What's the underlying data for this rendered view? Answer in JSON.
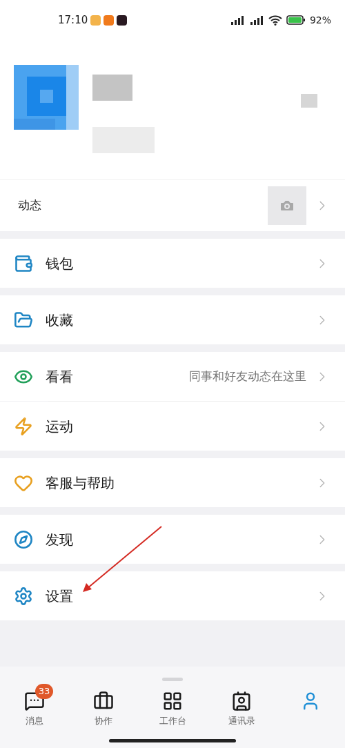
{
  "status_bar": {
    "time": "17:10",
    "battery": "92%"
  },
  "moments": {
    "label": "动态"
  },
  "sections": [
    [
      {
        "label": "钱包"
      }
    ],
    [
      {
        "label": "收藏"
      }
    ],
    [
      {
        "label": "看看",
        "hint": "同事和好友动态在这里"
      },
      {
        "label": "运动"
      }
    ],
    [
      {
        "label": "客服与帮助"
      }
    ],
    [
      {
        "label": "发现"
      }
    ],
    [
      {
        "label": "设置"
      }
    ]
  ],
  "tabs": [
    {
      "label": "消息",
      "badge": "33",
      "selected": false
    },
    {
      "label": "协作",
      "selected": false
    },
    {
      "label": "工作台",
      "selected": false
    },
    {
      "label": "通讯录",
      "selected": false
    },
    {
      "selected": true
    }
  ]
}
